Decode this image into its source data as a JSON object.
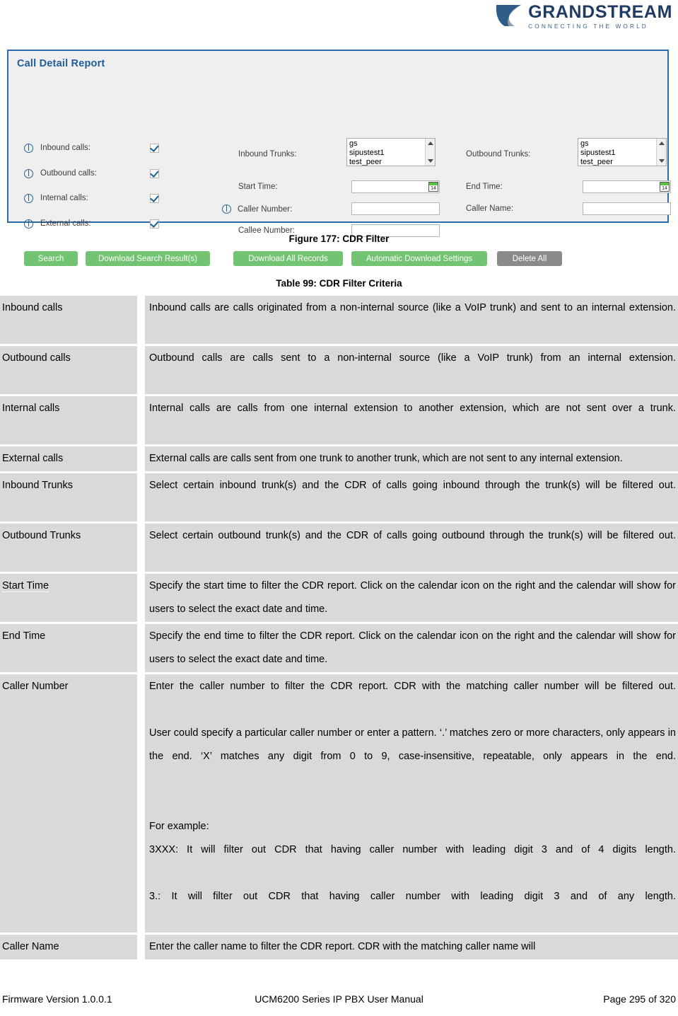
{
  "header": {
    "brand": "GRANDSTREAM",
    "tagline": "CONNECTING THE WORLD",
    "logo_icon": "grandstream-swoosh-icon"
  },
  "panel": {
    "title": "Call Detail Report",
    "checkboxes": [
      {
        "label": "Inbound calls:",
        "checked": true,
        "info_icon": "info-icon"
      },
      {
        "label": "Outbound calls:",
        "checked": true,
        "info_icon": "info-icon"
      },
      {
        "label": "Internal calls:",
        "checked": true,
        "info_icon": "info-icon"
      },
      {
        "label": "External calls:",
        "checked": true,
        "info_icon": "info-icon"
      }
    ],
    "fields": {
      "inbound_trunks_label": "Inbound Trunks:",
      "outbound_trunks_label": "Outbound Trunks:",
      "start_time_label": "Start Time:",
      "end_time_label": "End Time:",
      "caller_number_label": "Caller Number:",
      "caller_name_label": "Caller Name:",
      "callee_number_label": "Callee Number:"
    },
    "trunk_options": [
      "gs",
      "sipustest1",
      "test_peer"
    ],
    "values": {
      "start_time": "",
      "end_time": "",
      "caller_number": "",
      "caller_name": "",
      "callee_number": ""
    },
    "calendar_icon_text": "14",
    "buttons": [
      {
        "label": "Search",
        "style": "green"
      },
      {
        "label": "Download Search Result(s)",
        "style": "green"
      },
      {
        "label": "Download All Records",
        "style": "green"
      },
      {
        "label": "Automatic Download Settings",
        "style": "green"
      },
      {
        "label": "Delete All",
        "style": "gray"
      }
    ],
    "colors": {
      "border": "#2b6cab",
      "title": "#1f5c99",
      "button_green": "#72c472",
      "button_gray": "#8a8a8a",
      "panel_bg": "#efefef"
    }
  },
  "figure_caption": "Figure 177: CDR Filter",
  "table_caption": "Table 99: CDR Filter Criteria",
  "criteria_rows": [
    {
      "key": "Inbound calls",
      "paragraphs": [
        "Inbound calls are calls originated from a non-internal source (like a VoIP trunk) and sent to an internal extension."
      ]
    },
    {
      "key": "Outbound calls",
      "paragraphs": [
        "Outbound calls are calls sent to a non-internal source (like a VoIP trunk) from an internal extension."
      ]
    },
    {
      "key": "Internal calls",
      "paragraphs": [
        "Internal calls are calls from one internal extension to another extension, which are not sent over a trunk."
      ]
    },
    {
      "key": "External calls",
      "paragraphs": [
        "External calls are calls sent from one trunk to another trunk, which are not sent to any internal extension."
      ]
    },
    {
      "key": "Inbound Trunks",
      "paragraphs": [
        "Select certain inbound trunk(s) and the CDR of calls going inbound through the trunk(s) will be filtered out."
      ]
    },
    {
      "key": "Outbound Trunks",
      "paragraphs": [
        "Select certain outbound trunk(s) and the CDR of calls going outbound through the trunk(s) will be filtered out."
      ]
    },
    {
      "key": "Start Time",
      "paragraphs": [
        "Specify the start time to filter the CDR report. Click on the calendar icon on the right and the calendar will show for users to select the exact date and time."
      ]
    },
    {
      "key": "End Time",
      "paragraphs": [
        "Specify the end time to filter the CDR report. Click on the calendar icon on the right and the calendar will show for users to select the exact date and time."
      ]
    },
    {
      "key": "Caller Number",
      "paragraphs": [
        "Enter the caller number to filter the CDR report. CDR with the matching caller number will be filtered out.",
        "User could specify a particular caller number or enter a pattern. ‘.’ matches zero or more characters, only appears in the end. ‘X’ matches any digit from 0 to 9, case-insensitive, repeatable, only appears in the end.",
        "",
        "For example:",
        "3XXX: It will filter out CDR that having caller number with leading digit 3 and of 4 digits length.",
        "3.: It will filter out CDR that having caller number with leading digit 3 and of any length."
      ]
    },
    {
      "key": "Caller Name",
      "paragraphs": [
        "Enter the caller name to filter the CDR report. CDR with the matching caller name will"
      ]
    }
  ],
  "footer": {
    "firmware": "Firmware Version 1.0.0.1",
    "manual": "UCM6200 Series IP PBX User Manual",
    "page": "Page 295 of 320"
  }
}
